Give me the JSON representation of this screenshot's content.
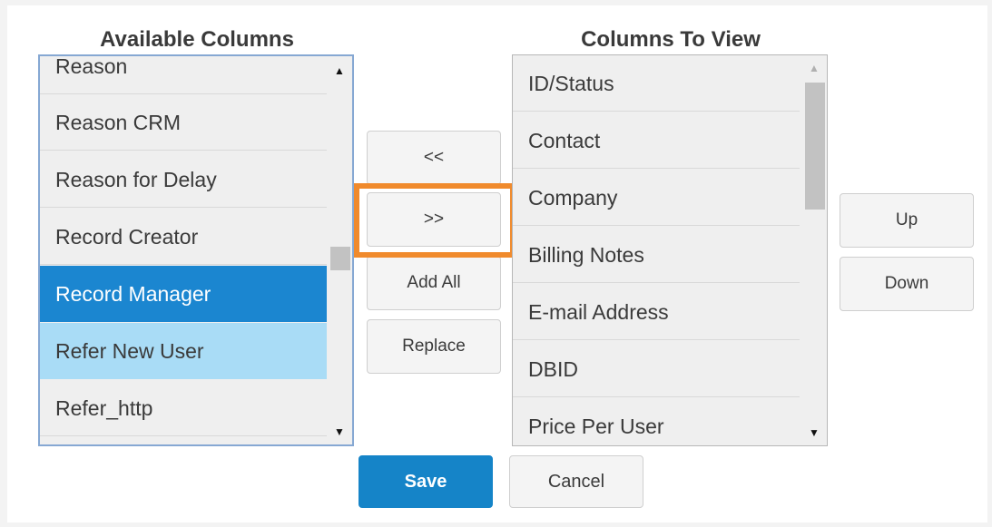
{
  "available": {
    "title": "Available Columns",
    "items": [
      {
        "label": "Reason"
      },
      {
        "label": "Reason CRM"
      },
      {
        "label": "Reason for Delay"
      },
      {
        "label": "Record Creator"
      },
      {
        "label": "Record Manager",
        "state": "selected"
      },
      {
        "label": "Refer New User",
        "state": "hover"
      },
      {
        "label": "Refer_http"
      }
    ]
  },
  "view": {
    "title": "Columns To View",
    "items": [
      {
        "label": "ID/Status"
      },
      {
        "label": "Contact"
      },
      {
        "label": "Company"
      },
      {
        "label": "Billing Notes"
      },
      {
        "label": "E-mail Address"
      },
      {
        "label": "DBID"
      },
      {
        "label": "Price Per User"
      }
    ]
  },
  "buttons": {
    "remove": "<<",
    "add": ">>",
    "add_all": "Add All",
    "replace": "Replace",
    "up": "Up",
    "down": "Down",
    "save": "Save",
    "cancel": "Cancel"
  },
  "icons": {
    "scroll_up": "▲",
    "scroll_down": "▼"
  },
  "colors": {
    "selected_bg": "#1b86d0",
    "hover_bg": "#a9dcf6",
    "highlight": "#f08a2c",
    "primary": "#1584c8"
  }
}
